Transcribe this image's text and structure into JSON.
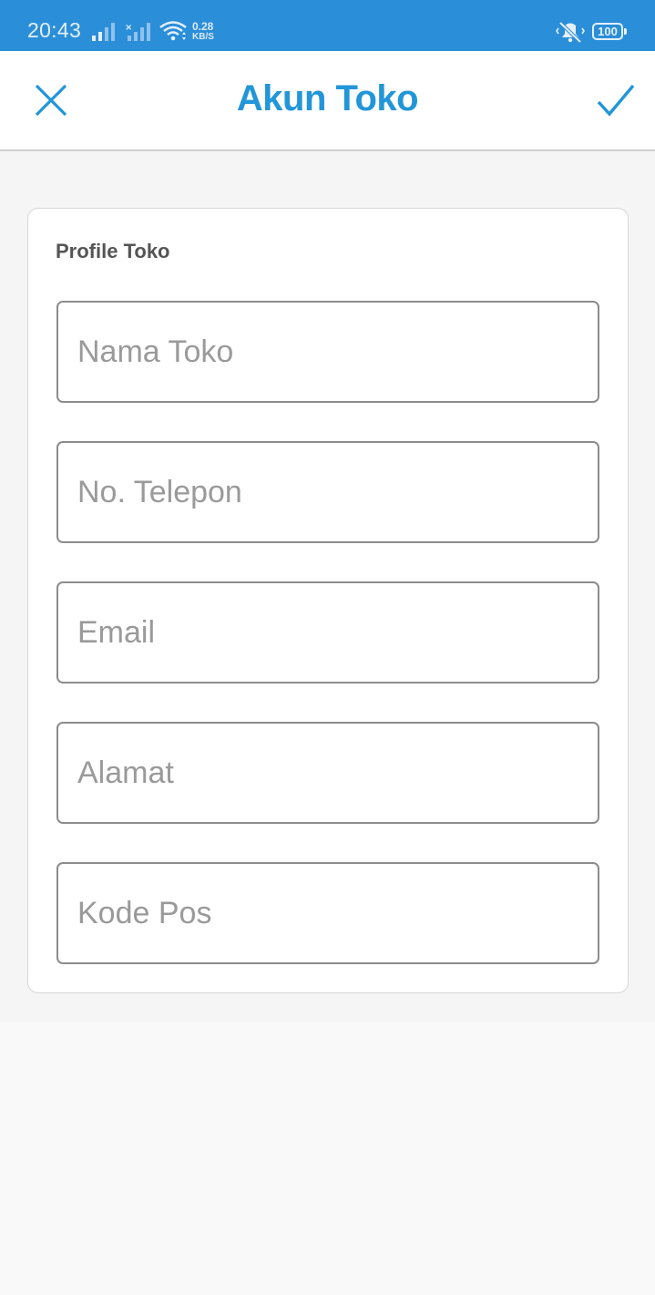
{
  "status_bar": {
    "time": "20:43",
    "net_speed_value": "0.28",
    "net_speed_unit": "KB/S",
    "battery": "100",
    "icons": [
      "signal-icon",
      "signal-no-data-icon",
      "wifi-icon",
      "mute-vibrate-icon",
      "battery-icon"
    ]
  },
  "app_bar": {
    "title": "Akun Toko",
    "close_icon": "close-icon",
    "confirm_icon": "check-icon",
    "accent_color": "#2196d8"
  },
  "form": {
    "section_title": "Profile Toko",
    "fields": [
      {
        "placeholder": "Nama Toko",
        "value": ""
      },
      {
        "placeholder": "No. Telepon",
        "value": ""
      },
      {
        "placeholder": "Email",
        "value": ""
      },
      {
        "placeholder": "Alamat",
        "value": ""
      },
      {
        "placeholder": "Kode Pos",
        "value": ""
      }
    ]
  },
  "colors": {
    "status_bar": "#2b8ed8",
    "field_border": "#8c8c8c",
    "placeholder": "#9a9a9a"
  }
}
